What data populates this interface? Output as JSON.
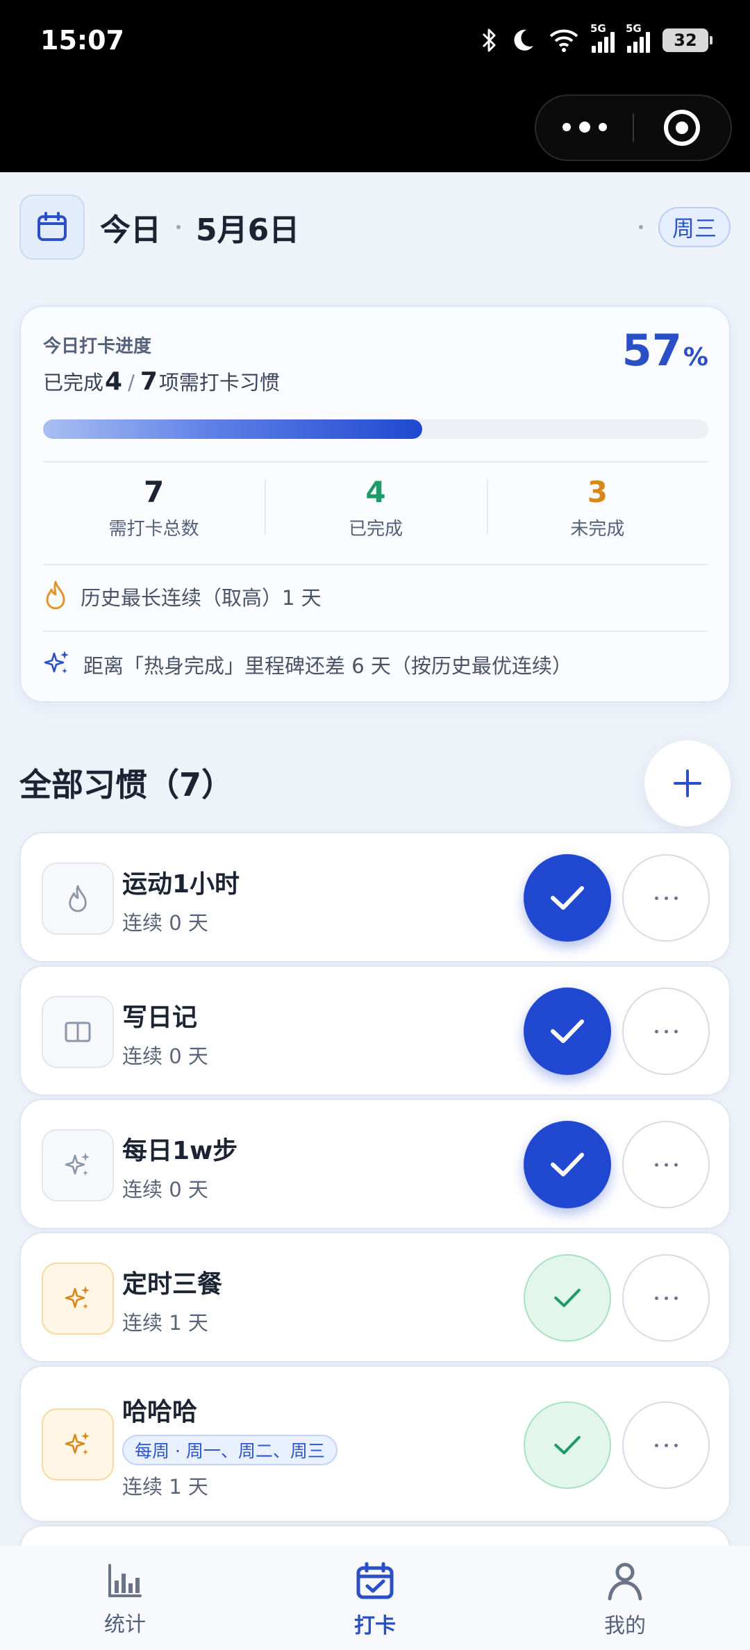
{
  "status_bar": {
    "time": "15:07",
    "network1": "5G",
    "network2": "5G",
    "battery": "32",
    "icons": [
      "bluetooth-icon",
      "moon-icon",
      "wifi-icon",
      "signal-icon",
      "signal-icon",
      "battery-icon"
    ]
  },
  "header": {
    "title": "今日",
    "date": "5月6日",
    "weekday": "周三",
    "icon": "calendar-icon"
  },
  "progress": {
    "label": "今日打卡进度",
    "completed_prefix": "已完成",
    "completed": "4",
    "slash": "/",
    "total": "7",
    "completed_suffix": "项需打卡习惯",
    "percent": "57",
    "percent_sign": "%",
    "fill_fraction": 0.57,
    "stats": [
      {
        "value": "7",
        "label": "需打卡总数",
        "color": "#1c2333"
      },
      {
        "value": "4",
        "label": "已完成",
        "color": "#1f9a6a"
      },
      {
        "value": "3",
        "label": "未完成",
        "color": "#d9861a"
      }
    ],
    "history_text": "历史最长连续（取高）1 天",
    "history_icon": "flame-icon",
    "milestone_text": "距离「热身完成」里程碑还差 6 天（按历史最优连续）",
    "milestone_icon": "sparkle-icon"
  },
  "habits": {
    "title": "全部习惯（7）",
    "add_icon": "plus-icon",
    "items": [
      {
        "name": "运动1小时",
        "streak": "连续 0 天",
        "icon": "flame-icon",
        "status": "done"
      },
      {
        "name": "写日记",
        "streak": "连续 0 天",
        "icon": "book-icon",
        "status": "done"
      },
      {
        "name": "每日1w步",
        "streak": "连续 0 天",
        "icon": "sparkle-icon",
        "status": "done"
      },
      {
        "name": "定时三餐",
        "streak": "连续 1 天",
        "icon": "sparkle-icon",
        "status": "soft"
      },
      {
        "name": "哈哈哈",
        "tag": "每周 · 周一、周二、周三",
        "streak": "连续 1 天",
        "icon": "sparkle-icon",
        "status": "soft"
      }
    ]
  },
  "tabbar": {
    "tabs": [
      {
        "label": "统计",
        "icon": "bar-chart-icon",
        "active": false
      },
      {
        "label": "打卡",
        "icon": "calendar-check-icon",
        "active": true
      },
      {
        "label": "我的",
        "icon": "user-icon",
        "active": false
      }
    ]
  },
  "colors": {
    "accent": "#2148d0",
    "done_green": "#1f9a6a",
    "pending_amber": "#d9861a"
  }
}
